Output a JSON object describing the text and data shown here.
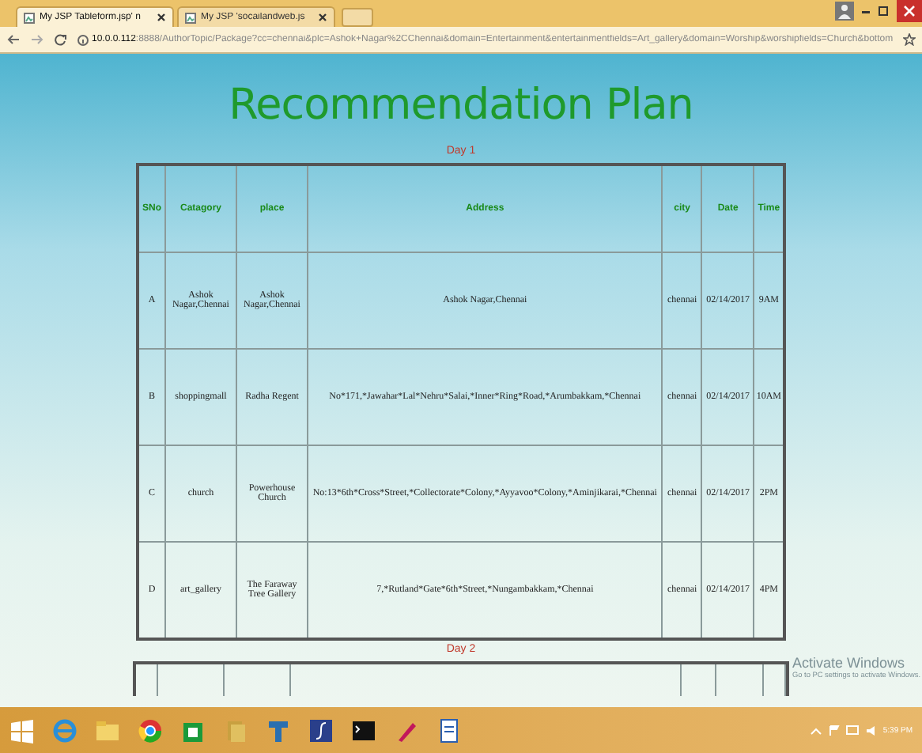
{
  "browser": {
    "tabs": [
      {
        "title": "My JSP Tableform.jsp' n",
        "selected": true
      },
      {
        "title": "My JSP 'socailandweb.js",
        "selected": false
      }
    ],
    "url_host": "10.0.0.112",
    "url_rest": ":8888/AuthorTopic/Package?cc=chennai&plc=Ashok+Nagar%2CChennai&domain=Entertainment&entertainmentfields=Art_gallery&domain=Worship&worshipfields=Church&bottom"
  },
  "page": {
    "heading": "Recommendation Plan",
    "days": [
      {
        "label": "Day 1",
        "columns": [
          "SNo",
          "Catagory",
          "place",
          "Address",
          "city",
          "Date",
          "Time"
        ],
        "rows": [
          [
            "A",
            "Ashok Nagar,Chennai",
            "Ashok Nagar,Chennai",
            "Ashok Nagar,Chennai",
            "chennai",
            "02/14/2017",
            "9AM"
          ],
          [
            "B",
            "shoppingmall",
            "Radha Regent",
            "No*171,*Jawahar*Lal*Nehru*Salai,*Inner*Ring*Road,*Arumbakkam,*Chennai",
            "chennai",
            "02/14/2017",
            "10AM"
          ],
          [
            "C",
            "church",
            "Powerhouse Church",
            "No:13*6th*Cross*Street,*Collectorate*Colony,*Ayyavoo*Colony,*Aminjikarai,*Chennai",
            "chennai",
            "02/14/2017",
            "2PM"
          ],
          [
            "D",
            "art_gallery",
            "The Faraway Tree Gallery",
            "7,*Rutland*Gate*6th*Street,*Nungambakkam,*Chennai",
            "chennai",
            "02/14/2017",
            "4PM"
          ]
        ]
      },
      {
        "label": "Day 2"
      }
    ]
  },
  "activation": {
    "title": "Activate Windows",
    "hint": "Go to PC settings to activate Windows."
  },
  "taskbar": {
    "clock": "5:39 PM"
  }
}
